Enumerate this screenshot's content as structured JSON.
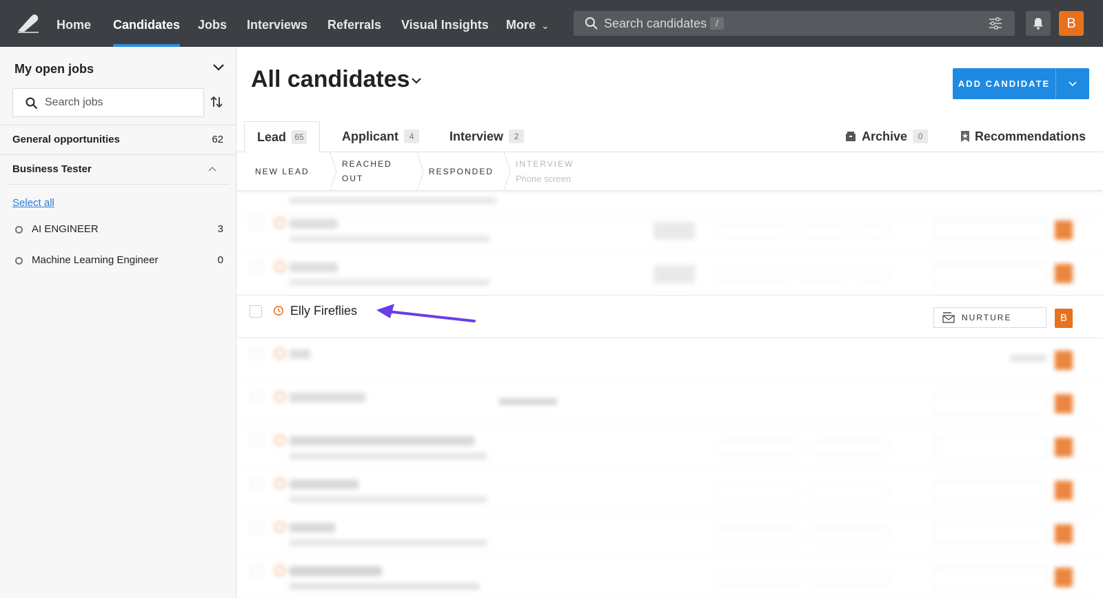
{
  "nav": {
    "items": [
      {
        "label": "Home"
      },
      {
        "label": "Candidates",
        "active": true
      },
      {
        "label": "Jobs"
      },
      {
        "label": "Interviews"
      },
      {
        "label": "Referrals"
      },
      {
        "label": "Visual Insights"
      },
      {
        "label": "More"
      }
    ],
    "search_placeholder": "Search candidates",
    "search_shortcut": "/",
    "user_initial": "B"
  },
  "sidebar": {
    "title": "My open jobs",
    "search_placeholder": "Search jobs",
    "general": {
      "label": "General opportunities",
      "count": "62"
    },
    "group": {
      "label": "Business Tester"
    },
    "select_all": "Select all",
    "jobs": [
      {
        "label": "AI ENGINEER",
        "count": "3"
      },
      {
        "label": "Machine Learning Engineer",
        "count": "0"
      }
    ]
  },
  "main": {
    "title": "All candidates",
    "add_button": "ADD CANDIDATE",
    "tabs": [
      {
        "label": "Lead",
        "count": "65"
      },
      {
        "label": "Applicant",
        "count": "4"
      },
      {
        "label": "Interview",
        "count": "2"
      },
      {
        "label": "Archive",
        "count": "0"
      },
      {
        "label": "Recommendations"
      }
    ],
    "stages": [
      {
        "label": "NEW LEAD"
      },
      {
        "label": "REACHED",
        "label2": "OUT"
      },
      {
        "label": "RESPONDED"
      },
      {
        "label": "INTERVIEW",
        "sub": "Phone screen"
      }
    ],
    "focused_row": {
      "name": "Elly Fireflies",
      "action": "NURTURE",
      "avatar": "B"
    }
  },
  "colors": {
    "nav_bg": "#3c3f44",
    "accent_blue": "#1e8ae2",
    "orange": "#e8711d",
    "arrow": "#6a3de8"
  }
}
